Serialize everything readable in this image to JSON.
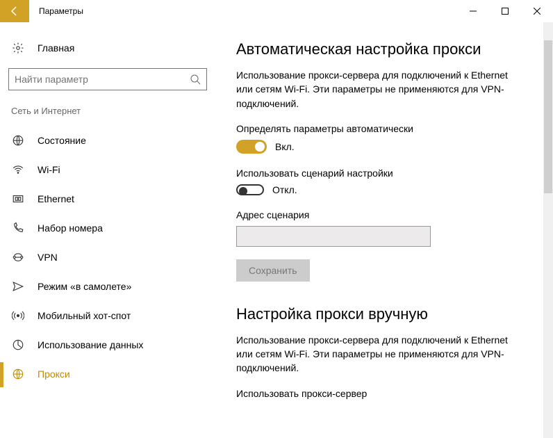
{
  "titlebar": {
    "title": "Параметры"
  },
  "sidebar": {
    "home": "Главная",
    "search_placeholder": "Найти параметр",
    "category": "Сеть и Интернет",
    "items": [
      {
        "label": "Состояние"
      },
      {
        "label": "Wi-Fi"
      },
      {
        "label": "Ethernet"
      },
      {
        "label": "Набор номера"
      },
      {
        "label": "VPN"
      },
      {
        "label": "Режим «в самолете»"
      },
      {
        "label": "Мобильный хот-спот"
      },
      {
        "label": "Использование данных"
      },
      {
        "label": "Прокси"
      }
    ],
    "selected_index": 8
  },
  "content": {
    "auto_heading": "Автоматическая настройка прокси",
    "auto_desc": "Использование прокси-сервера для подключений к Ethernet или сетям Wi-Fi. Эти параметры не применяются для VPN-подключений.",
    "auto_detect_label": "Определять параметры автоматически",
    "auto_detect_state": "Вкл.",
    "use_script_label": "Использовать сценарий настройки",
    "use_script_state": "Откл.",
    "script_address_label": "Адрес сценария",
    "script_address_value": "",
    "save_label": "Сохранить",
    "manual_heading": "Настройка прокси вручную",
    "manual_desc": "Использование прокси-сервера для подключений к Ethernet или сетям Wi-Fi. Эти параметры не применяются для VPN-подключений.",
    "use_proxy_label": "Использовать прокси-сервер"
  }
}
